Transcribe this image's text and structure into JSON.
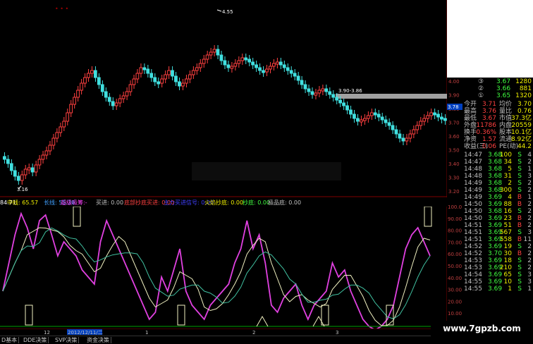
{
  "colors": {
    "up": "#ff4040",
    "down": "#40e0e0",
    "white": "#f0f0f0",
    "yellow": "#f0f000",
    "magenta": "#e040e0",
    "green": "#40ff40"
  },
  "main_chart": {
    "high_label": "4.55",
    "low_label": "3.16",
    "range_label": "3.90-3.86",
    "price_axis": [
      "4.00",
      "3.90",
      "3.80",
      "3.70",
      "3.60",
      "3.50",
      "3.40",
      "3.30",
      "3.20"
    ],
    "current_price_tag": "3.78"
  },
  "indicator": {
    "labels": [
      {
        "text": "84.71",
        "color": "#ffffff"
      },
      {
        "text": "中线: 65.57",
        "color": "#f0f000"
      },
      {
        "text": "长线: 55.28",
        "color": "#40a0ff"
      },
      {
        "text": "超级吸筹:-",
        "color": "#ff40ff"
      },
      {
        "text": "买进: 0.00",
        "color": "#c0c0c0"
      },
      {
        "text": "底部抄底买进: 0.00",
        "color": "#ff4040"
      },
      {
        "text": "主力买进信号: 0.00",
        "color": "#4040ff"
      },
      {
        "text": "火焰抄底: 0.00",
        "color": "#f0f000"
      },
      {
        "text": "抄底: 0.00",
        "color": "#40ff40"
      },
      {
        "text": "极品底: 0.00",
        "color": "#c0c0c0"
      }
    ],
    "axis": [
      "100.0",
      "90.00",
      "80.00",
      "70.00",
      "60.00",
      "50.00",
      "40.00",
      "30.00",
      "20.00",
      "10.00"
    ]
  },
  "time_axis": {
    "labels": [
      "12",
      "2012/12/11/二",
      "1",
      "2",
      "3"
    ]
  },
  "quote_panel": {
    "orders": [
      {
        "idx": "③",
        "price": "3.67",
        "vol": "1280"
      },
      {
        "idx": "②",
        "price": "3.66",
        "vol": "881"
      },
      {
        "idx": "①",
        "price": "3.65",
        "vol": "1320"
      }
    ],
    "stats": [
      {
        "l1": "今开",
        "v1": "3.71",
        "l2": "均价",
        "v2": "3.70"
      },
      {
        "l1": "最高",
        "v1": "3.76",
        "l2": "量比",
        "v2": "0.76"
      },
      {
        "l1": "最低",
        "v1": "3.67",
        "l2": "市值",
        "v2": "37.3亿"
      },
      {
        "l1": "外盘",
        "v1": "11786",
        "l2": "内盘",
        "v2": "20559"
      },
      {
        "l1": "换手",
        "v1": "0.36%",
        "l2": "股本",
        "v2": "10.1亿"
      },
      {
        "l1": "净资",
        "v1": "1.57",
        "l2": "流通",
        "v2": "8.92亿"
      },
      {
        "l1": "收益(三)",
        "v1": "0.06",
        "l2": "PE(动)",
        "v2": "44.2"
      }
    ],
    "ticks": [
      {
        "t": "14:47",
        "p": "3.68",
        "v": "100",
        "d": "S",
        "n": "4"
      },
      {
        "t": "14:47",
        "p": "3.68",
        "v": "34",
        "d": "S",
        "n": "2"
      },
      {
        "t": "14:48",
        "p": "3.68",
        "v": "5",
        "d": "S",
        "n": "1"
      },
      {
        "t": "14:48",
        "p": "3.68",
        "v": "31",
        "d": "S",
        "n": "3"
      },
      {
        "t": "14:49",
        "p": "3.68",
        "v": "2",
        "d": "S",
        "n": "2"
      },
      {
        "t": "14:49",
        "p": "3.68",
        "v": "300",
        "d": "S",
        "n": "2"
      },
      {
        "t": "14:49",
        "p": "3.69",
        "v": "4",
        "d": "B",
        "n": "1"
      },
      {
        "t": "14:50",
        "p": "3.69",
        "v": "88",
        "d": "B",
        "n": "2"
      },
      {
        "t": "14:50",
        "p": "3.68",
        "v": "16",
        "d": "S",
        "n": "2"
      },
      {
        "t": "14:50",
        "p": "3.69",
        "v": "23",
        "d": "B",
        "n": "2"
      },
      {
        "t": "14:51",
        "p": "3.69",
        "v": "51",
        "d": "B",
        "n": "2"
      },
      {
        "t": "14:51",
        "p": "3.69",
        "v": "567",
        "d": "S",
        "n": "3"
      },
      {
        "t": "14:51",
        "p": "3.69",
        "v": "558",
        "d": "B",
        "n": "11"
      },
      {
        "t": "14:52",
        "p": "3.69",
        "v": "19",
        "d": "S",
        "n": "2"
      },
      {
        "t": "14:52",
        "p": "3.70",
        "v": "30",
        "d": "B",
        "n": "2"
      },
      {
        "t": "14:53",
        "p": "3.69",
        "v": "18",
        "d": "S",
        "n": "2"
      },
      {
        "t": "14:53",
        "p": "3.69",
        "v": "210",
        "d": "S",
        "n": "2"
      },
      {
        "t": "14:54",
        "p": "3.69",
        "v": "65",
        "d": "S",
        "n": "3"
      },
      {
        "t": "14:55",
        "p": "3.69",
        "v": "10",
        "d": "S",
        "n": "3"
      },
      {
        "t": "14:55",
        "p": "3.69",
        "v": "1",
        "d": "S",
        "n": "1"
      }
    ]
  },
  "tabs": [
    "D基本",
    "DDE决策",
    "SVP决策",
    "资金决策"
  ],
  "watermark": "www.7gpzb.com"
}
